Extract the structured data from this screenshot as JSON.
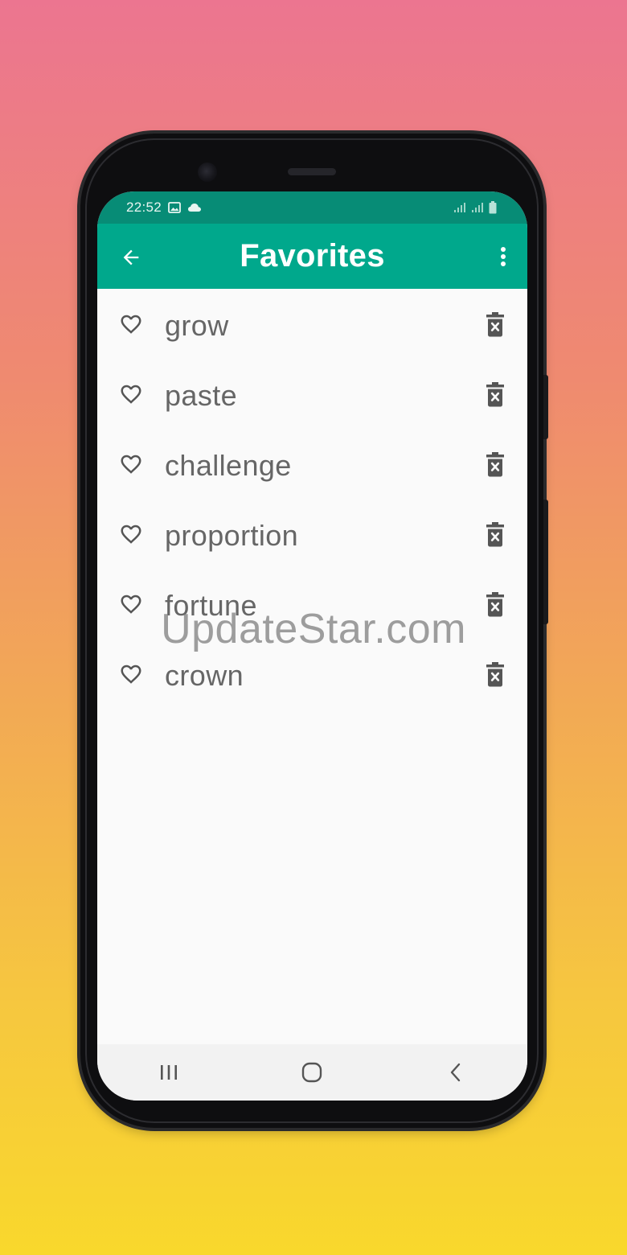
{
  "status_bar": {
    "time": "22:52",
    "icons": [
      "image-icon",
      "cloud-icon",
      "signal-icon",
      "signal-icon-2",
      "battery-icon"
    ]
  },
  "app_bar": {
    "title": "Favorites",
    "back_icon": "arrow-back-icon",
    "menu_icon": "more-vert-icon"
  },
  "favorites": [
    {
      "word": "grow"
    },
    {
      "word": "paste"
    },
    {
      "word": "challenge"
    },
    {
      "word": "proportion"
    },
    {
      "word": "fortune"
    },
    {
      "word": "crown"
    }
  ],
  "icons": {
    "favorite": "heart-outline-icon",
    "delete": "delete-forever-icon"
  },
  "watermark": "UpdateStar.com",
  "nav_bar": {
    "icons": [
      "recents-icon",
      "home-icon",
      "back-icon"
    ]
  },
  "colors": {
    "app_bar": "#00a88c",
    "status_bar": "#078c76",
    "word_text": "#666666",
    "icon": "#555555"
  }
}
